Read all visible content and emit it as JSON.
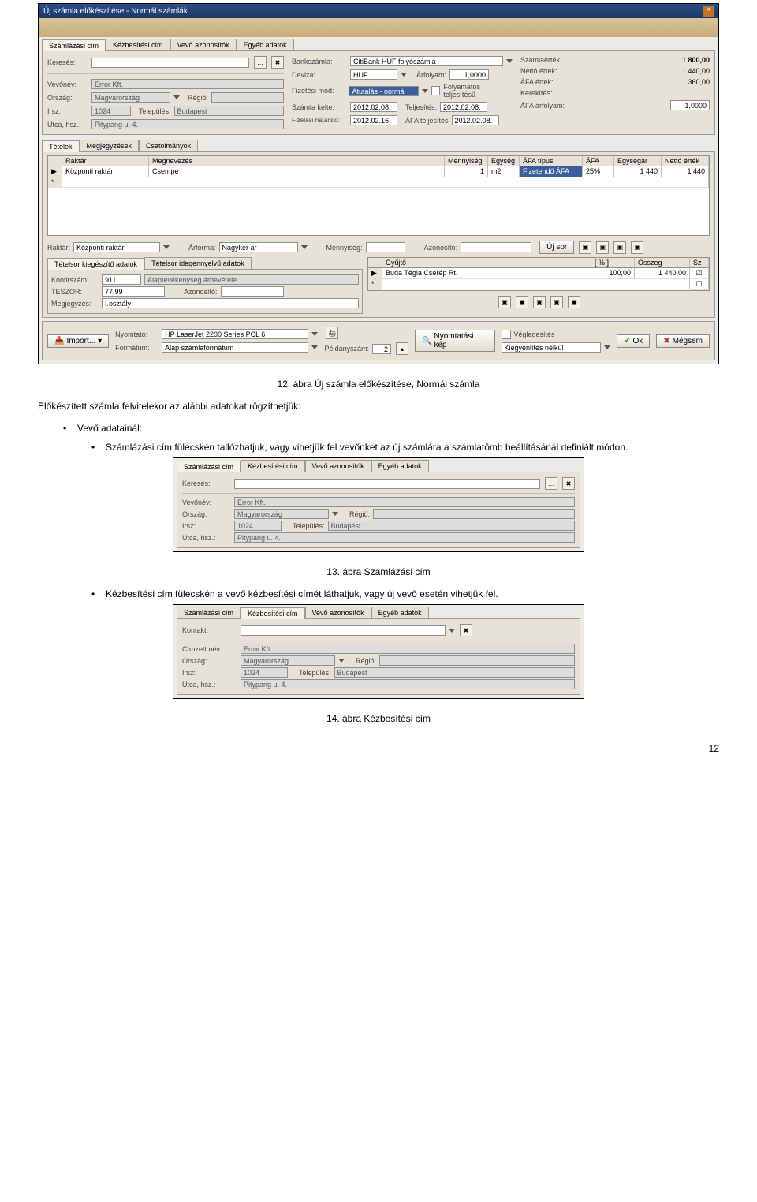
{
  "screenshot1": {
    "title": "Új számla előkészítése - Normál számlák",
    "top_tabs": [
      "Számlázási cím",
      "Kézbesítési cím",
      "Vevő azonosítók",
      "Egyéb adatok"
    ],
    "kereses_label": "Keresés:",
    "customer": {
      "vevonev_label": "Vevőnév:",
      "vevonev": "Error Kft.",
      "orszag_label": "Ország:",
      "orszag": "Magyarország",
      "regio_label": "Régió:",
      "irsz_label": "Irsz:",
      "irsz": "1024",
      "telepules_label": "Település:",
      "telepules": "Budapest",
      "utca_label": "Utca, hsz.:",
      "utca": "Pitypang u. 4."
    },
    "bank": {
      "bankszamla_label": "Bankszámla:",
      "bankszamla": "CitiBank HUF folyószámla",
      "deviza_label": "Deviza:",
      "deviza": "HUF",
      "arfolyam_label": "Árfolyam:",
      "arfolyam": "1,0000",
      "fizmod_label": "Fizetési mód:",
      "fizmod": "Átutalás - normál",
      "folyamatos_label": "Folyamatos teljesítésű",
      "szamla_kelte_label": "Számla kelte:",
      "szamla_kelte": "2012.02.08.",
      "teljesites_label": "Teljesítés:",
      "teljesites": "2012.02.08.",
      "fiz_hatarido_label": "Fizetési határidő:",
      "fiz_hatarido": "2012.02.16.",
      "afa_telj_label": "ÁFA teljesítés",
      "afa_telj": "2012.02.08."
    },
    "totals": {
      "szamlaertek_label": "Számlaérték:",
      "szamlaertek": "1 800,00",
      "netto_label": "Nettó érték:",
      "netto": "1 440,00",
      "afa_label": "ÁFA érték:",
      "afa": "360,00",
      "kerekites_label": "Kerekítés:",
      "afa_arf_label": "ÁFA árfolyam:",
      "afa_arf": "1,0000"
    },
    "tetel_tabs": [
      "Tételek",
      "Megjegyzések",
      "Csatolmányok"
    ],
    "tetel_headers": [
      "",
      "Raktár",
      "Megnevezés",
      "Mennyiség",
      "Egység",
      "ÁFA típus",
      "ÁFA",
      "Egységár",
      "Nettó érték"
    ],
    "tetel_row": {
      "raktar": "Központi raktár",
      "megnevezes": "Csempe",
      "mennyiseg": "1",
      "egyseg": "m2",
      "afa_tipus": "Fizetendő ÁFA",
      "afa": "25%",
      "egysegar": "1 440",
      "netto": "1 440"
    },
    "raktar_row": {
      "raktar_label": "Raktár:",
      "raktar": "Központi raktár",
      "arforma_label": "Árforma:",
      "arforma": "Nagyker ár",
      "mennyiseg_label": "Mennyiség:",
      "azonosito_label": "Azonosító:",
      "uj_sor_label": "Új sor"
    },
    "tetelsor_tabs": [
      "Tételsor kiegészítő adatok",
      "Tételsor idegennyelvű adatok"
    ],
    "tetelsor": {
      "kontirszam_label": "Kontirszám:",
      "kontirszam": "911",
      "kontirszam_name": "Alaptevékenység árbevétele",
      "teszor_label": "TESZOR:",
      "teszor": "77.99",
      "azonosito_label": "Azonosító:",
      "megjegyzes_label": "Megjegyzés:",
      "megjegyzes": "I.osztály"
    },
    "right_grid": {
      "headers": [
        "",
        "Gyűjtő",
        "[ % ]",
        "Összeg",
        "Sz"
      ],
      "row": {
        "gyujto": "Buda Tégla Cserép Rt.",
        "szazalek": "100,00",
        "osszeg": "1 440,00"
      }
    },
    "footer": {
      "import_label": "Import...",
      "nyomtato_label": "Nyomtató:",
      "nyomtato": "HP LaserJet 2200 Series PCL 6",
      "formatum_label": "Formátum:",
      "formatum": "Alap számlaformátum",
      "peldany_label": "Példányszám:",
      "peldany": "2",
      "nyomtkep_label": "Nyomtatási kép",
      "veglegesites_label": "Véglegesítés",
      "kiegyenlites_label": "Kiegyenlítés nélkül",
      "ok_label": "Ok",
      "megsem_label": "Mégsem"
    }
  },
  "caption1": "12. ábra Új számla előkészítése, Normál számla",
  "body1": "Előkészített számla felvitelekor az alábbi adatokat rögzíthetjük:",
  "li1": "Vevő adatainál:",
  "li1a": "Számlázási cím fülecskén tallózhatjuk, vagy vihetjük fel vevőnket az új számlára a számlatömb beállításánál definiált módon.",
  "screenshot2": {
    "tabs": [
      "Számlázási cím",
      "Kézbesítési cím",
      "Vevő azonosítók",
      "Egyéb adatok"
    ],
    "kereses_label": "Keresés:",
    "vevonev_label": "Vevőnév:",
    "vevonev": "Error Kft.",
    "orszag_label": "Ország:",
    "orszag": "Magyarország",
    "regio_label": "Régió:",
    "irsz_label": "Irsz:",
    "irsz": "1024",
    "telepules_label": "Település:",
    "telepules": "Budapest",
    "utca_label": "Utca, hsz.:",
    "utca": "Pitypang u. 4."
  },
  "caption2": "13. ábra Számlázási cím",
  "li1b": "Kézbesítési cím fülecskén a vevő kézbesítési címét láthatjuk, vagy új vevő esetén vihetjük fel.",
  "screenshot3": {
    "tabs": [
      "Számlázási cím",
      "Kézbesítési cím",
      "Vevő azonosítók",
      "Egyéb adatok"
    ],
    "kontakt_label": "Kontakt:",
    "cimzett_label": "Címzett név:",
    "cimzett": "Error Kft.",
    "orszag_label": "Ország:",
    "orszag": "Magyarország",
    "regio_label": "Régió:",
    "irsz_label": "Irsz:",
    "irsz": "1024",
    "telepules_label": "Település:",
    "telepules": "Budapest",
    "utca_label": "Utca, hsz.:",
    "utca": "Pitypang u. 4."
  },
  "caption3": "14. ábra Kézbesítési cím",
  "page_number": "12"
}
